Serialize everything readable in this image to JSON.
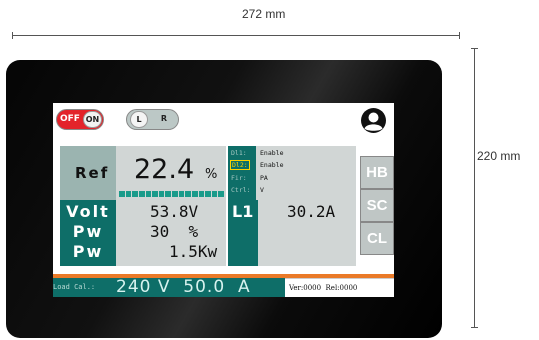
{
  "dimensions": {
    "width_label": "272 mm",
    "height_label": "220 mm"
  },
  "topbar": {
    "power_toggle": {
      "off_label": "OFF",
      "on_label": "ON",
      "state_color": "#e3232a"
    },
    "lr_toggle": {
      "left_label": "L",
      "right_label": "R"
    },
    "user_icon": "user-avatar-icon"
  },
  "ref": {
    "label": "Ref",
    "value": "22.4",
    "unit": "%"
  },
  "status": [
    {
      "key": "Dl1:",
      "value": "Enable"
    },
    {
      "key": "Dl2:",
      "value": "Enable"
    },
    {
      "key": "Fir:",
      "value": "PA"
    },
    {
      "key": "Ctrl:",
      "value": "V"
    }
  ],
  "side_buttons": [
    "HB",
    "SC",
    "CL"
  ],
  "readings": {
    "labels": [
      "Volt",
      "Pw",
      "Pw"
    ],
    "values": [
      "53.8V",
      "30  %",
      "1.5Kw"
    ]
  },
  "l1": {
    "label": "L1",
    "value": "30.2A"
  },
  "bottom": {
    "load_label": "Load Cal.:",
    "load_value": "240 V  50.0  A",
    "version": "Ver:0000  Rel:0000"
  },
  "colors": {
    "accent": "#0e6e68",
    "panel": "#d1d6d5",
    "label_bg": "#9bb4b0",
    "orange": "#ea7a28"
  }
}
